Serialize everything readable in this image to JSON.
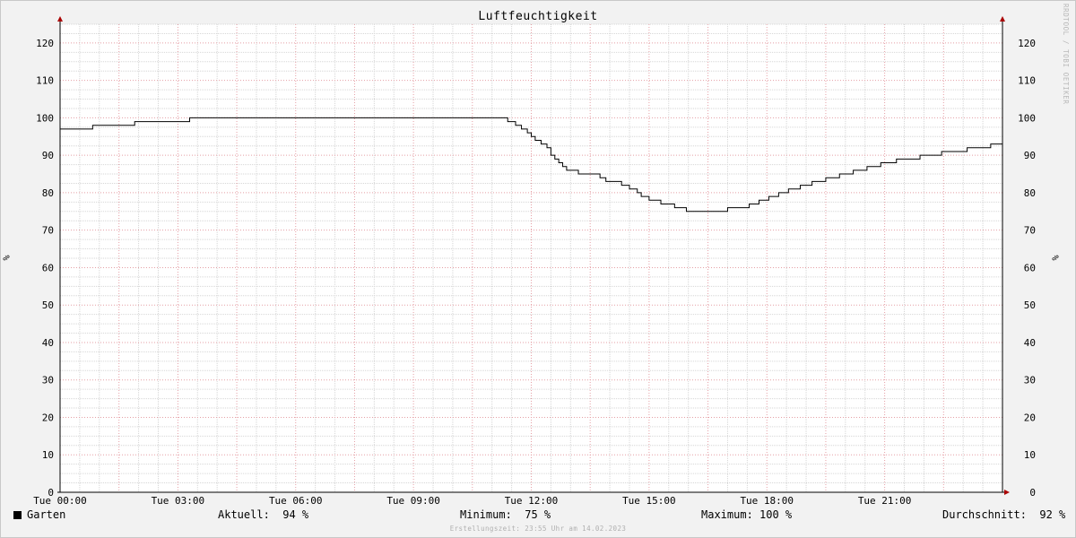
{
  "chart_data": {
    "type": "line",
    "title": "Luftfeuchtigkeit",
    "ylabel": "%",
    "ylabel_right": "%",
    "xlabel": "",
    "x_unit": "hours since Tue 00:00",
    "xlim": [
      0,
      24
    ],
    "ylim": [
      0,
      125
    ],
    "y_ticks": [
      0,
      10,
      20,
      30,
      40,
      50,
      60,
      70,
      80,
      90,
      100,
      110,
      120
    ],
    "x_ticks": [
      {
        "x": 0,
        "label": "Tue 00:00"
      },
      {
        "x": 3,
        "label": "Tue 03:00"
      },
      {
        "x": 6,
        "label": "Tue 06:00"
      },
      {
        "x": 9,
        "label": "Tue 09:00"
      },
      {
        "x": 12,
        "label": "Tue 12:00"
      },
      {
        "x": 15,
        "label": "Tue 15:00"
      },
      {
        "x": 18,
        "label": "Tue 18:00"
      },
      {
        "x": 21,
        "label": "Tue 21:00"
      }
    ],
    "grid": true,
    "series": [
      {
        "name": "Garten",
        "color": "#000000",
        "step": true,
        "x": [
          0,
          0.83,
          1.9,
          3.3,
          11.4,
          11.6,
          11.75,
          11.9,
          12.0,
          12.1,
          12.25,
          12.4,
          12.5,
          12.6,
          12.7,
          12.8,
          12.9,
          13.0,
          13.2,
          13.5,
          13.75,
          13.9,
          14.1,
          14.3,
          14.5,
          14.7,
          14.8,
          15.0,
          15.3,
          15.65,
          15.95,
          17.0,
          17.55,
          17.8,
          18.05,
          18.3,
          18.55,
          18.85,
          19.15,
          19.5,
          19.85,
          20.2,
          20.55,
          20.9,
          21.3,
          21.9,
          22.45,
          23.1,
          23.7
        ],
        "y": [
          97,
          98,
          99,
          100,
          99,
          98,
          97,
          96,
          95,
          94,
          93,
          92,
          90,
          89,
          88,
          87,
          86,
          86,
          85,
          85,
          84,
          83,
          83,
          82,
          81,
          80,
          79,
          78,
          77,
          76,
          75,
          76,
          77,
          78,
          79,
          80,
          81,
          82,
          83,
          84,
          85,
          86,
          87,
          88,
          89,
          90,
          91,
          92,
          93
        ]
      }
    ]
  },
  "legend": {
    "series_name": "Garten",
    "aktuell": "Aktuell:  94 %",
    "minimum": "Minimum:  75 %",
    "maximum": "Maximum: 100 %",
    "durchschnitt": "Durchschnitt:  92 %"
  },
  "watermark": "RRDTOOL / TOBI OETIKER",
  "footer": "Erstellungszeit: 23:55 Uhr am 14.02.2023",
  "colors": {
    "background": "#f2f2f2",
    "plot_background": "#ffffff",
    "minor_grid": "#d6d6d6",
    "major_grid": "#e59fa5",
    "axis": "#000000",
    "arrow": "#aa0000"
  }
}
